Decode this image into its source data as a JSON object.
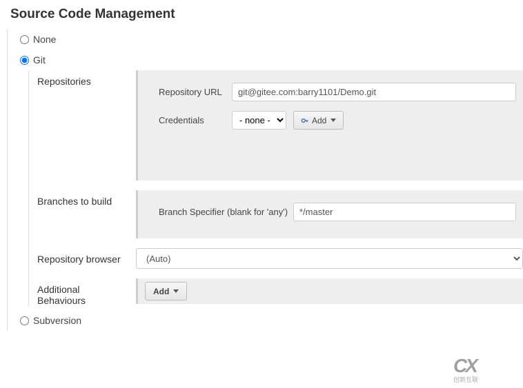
{
  "title": "Source Code Management",
  "scm_options": {
    "none": "None",
    "git": "Git",
    "subversion": "Subversion",
    "selected": "git"
  },
  "git": {
    "repositories": {
      "label": "Repositories",
      "url_label": "Repository URL",
      "url_value": "git@gitee.com:barry1101/Demo.git",
      "credentials_label": "Credentials",
      "credentials_value": "- none -",
      "add_label": "Add"
    },
    "branches": {
      "label": "Branches to build",
      "specifier_label": "Branch Specifier (blank for 'any')",
      "specifier_value": "*/master"
    },
    "browser": {
      "label": "Repository browser",
      "value": "(Auto)"
    },
    "behaviours": {
      "label": "Additional Behaviours",
      "add_label": "Add"
    }
  }
}
